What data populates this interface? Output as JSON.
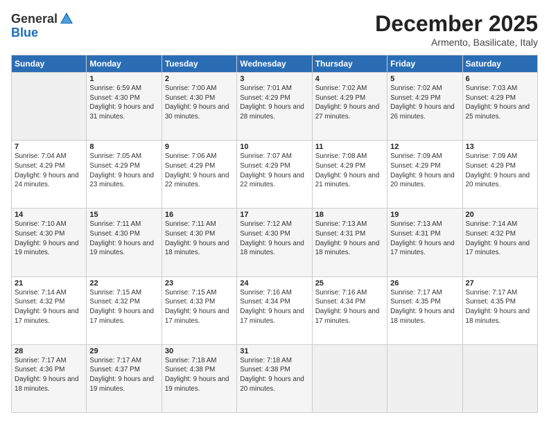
{
  "header": {
    "logo_general": "General",
    "logo_blue": "Blue",
    "month": "December 2025",
    "location": "Armento, Basilicate, Italy"
  },
  "weekdays": [
    "Sunday",
    "Monday",
    "Tuesday",
    "Wednesday",
    "Thursday",
    "Friday",
    "Saturday"
  ],
  "weeks": [
    [
      {
        "day": "",
        "sunrise": "",
        "sunset": "",
        "daylight": ""
      },
      {
        "day": "1",
        "sunrise": "Sunrise: 6:59 AM",
        "sunset": "Sunset: 4:30 PM",
        "daylight": "Daylight: 9 hours and 31 minutes."
      },
      {
        "day": "2",
        "sunrise": "Sunrise: 7:00 AM",
        "sunset": "Sunset: 4:30 PM",
        "daylight": "Daylight: 9 hours and 30 minutes."
      },
      {
        "day": "3",
        "sunrise": "Sunrise: 7:01 AM",
        "sunset": "Sunset: 4:29 PM",
        "daylight": "Daylight: 9 hours and 28 minutes."
      },
      {
        "day": "4",
        "sunrise": "Sunrise: 7:02 AM",
        "sunset": "Sunset: 4:29 PM",
        "daylight": "Daylight: 9 hours and 27 minutes."
      },
      {
        "day": "5",
        "sunrise": "Sunrise: 7:02 AM",
        "sunset": "Sunset: 4:29 PM",
        "daylight": "Daylight: 9 hours and 26 minutes."
      },
      {
        "day": "6",
        "sunrise": "Sunrise: 7:03 AM",
        "sunset": "Sunset: 4:29 PM",
        "daylight": "Daylight: 9 hours and 25 minutes."
      }
    ],
    [
      {
        "day": "7",
        "sunrise": "Sunrise: 7:04 AM",
        "sunset": "Sunset: 4:29 PM",
        "daylight": "Daylight: 9 hours and 24 minutes."
      },
      {
        "day": "8",
        "sunrise": "Sunrise: 7:05 AM",
        "sunset": "Sunset: 4:29 PM",
        "daylight": "Daylight: 9 hours and 23 minutes."
      },
      {
        "day": "9",
        "sunrise": "Sunrise: 7:06 AM",
        "sunset": "Sunset: 4:29 PM",
        "daylight": "Daylight: 9 hours and 22 minutes."
      },
      {
        "day": "10",
        "sunrise": "Sunrise: 7:07 AM",
        "sunset": "Sunset: 4:29 PM",
        "daylight": "Daylight: 9 hours and 22 minutes."
      },
      {
        "day": "11",
        "sunrise": "Sunrise: 7:08 AM",
        "sunset": "Sunset: 4:29 PM",
        "daylight": "Daylight: 9 hours and 21 minutes."
      },
      {
        "day": "12",
        "sunrise": "Sunrise: 7:09 AM",
        "sunset": "Sunset: 4:29 PM",
        "daylight": "Daylight: 9 hours and 20 minutes."
      },
      {
        "day": "13",
        "sunrise": "Sunrise: 7:09 AM",
        "sunset": "Sunset: 4:29 PM",
        "daylight": "Daylight: 9 hours and 20 minutes."
      }
    ],
    [
      {
        "day": "14",
        "sunrise": "Sunrise: 7:10 AM",
        "sunset": "Sunset: 4:30 PM",
        "daylight": "Daylight: 9 hours and 19 minutes."
      },
      {
        "day": "15",
        "sunrise": "Sunrise: 7:11 AM",
        "sunset": "Sunset: 4:30 PM",
        "daylight": "Daylight: 9 hours and 19 minutes."
      },
      {
        "day": "16",
        "sunrise": "Sunrise: 7:11 AM",
        "sunset": "Sunset: 4:30 PM",
        "daylight": "Daylight: 9 hours and 18 minutes."
      },
      {
        "day": "17",
        "sunrise": "Sunrise: 7:12 AM",
        "sunset": "Sunset: 4:30 PM",
        "daylight": "Daylight: 9 hours and 18 minutes."
      },
      {
        "day": "18",
        "sunrise": "Sunrise: 7:13 AM",
        "sunset": "Sunset: 4:31 PM",
        "daylight": "Daylight: 9 hours and 18 minutes."
      },
      {
        "day": "19",
        "sunrise": "Sunrise: 7:13 AM",
        "sunset": "Sunset: 4:31 PM",
        "daylight": "Daylight: 9 hours and 17 minutes."
      },
      {
        "day": "20",
        "sunrise": "Sunrise: 7:14 AM",
        "sunset": "Sunset: 4:32 PM",
        "daylight": "Daylight: 9 hours and 17 minutes."
      }
    ],
    [
      {
        "day": "21",
        "sunrise": "Sunrise: 7:14 AM",
        "sunset": "Sunset: 4:32 PM",
        "daylight": "Daylight: 9 hours and 17 minutes."
      },
      {
        "day": "22",
        "sunrise": "Sunrise: 7:15 AM",
        "sunset": "Sunset: 4:32 PM",
        "daylight": "Daylight: 9 hours and 17 minutes."
      },
      {
        "day": "23",
        "sunrise": "Sunrise: 7:15 AM",
        "sunset": "Sunset: 4:33 PM",
        "daylight": "Daylight: 9 hours and 17 minutes."
      },
      {
        "day": "24",
        "sunrise": "Sunrise: 7:16 AM",
        "sunset": "Sunset: 4:34 PM",
        "daylight": "Daylight: 9 hours and 17 minutes."
      },
      {
        "day": "25",
        "sunrise": "Sunrise: 7:16 AM",
        "sunset": "Sunset: 4:34 PM",
        "daylight": "Daylight: 9 hours and 17 minutes."
      },
      {
        "day": "26",
        "sunrise": "Sunrise: 7:17 AM",
        "sunset": "Sunset: 4:35 PM",
        "daylight": "Daylight: 9 hours and 18 minutes."
      },
      {
        "day": "27",
        "sunrise": "Sunrise: 7:17 AM",
        "sunset": "Sunset: 4:35 PM",
        "daylight": "Daylight: 9 hours and 18 minutes."
      }
    ],
    [
      {
        "day": "28",
        "sunrise": "Sunrise: 7:17 AM",
        "sunset": "Sunset: 4:36 PM",
        "daylight": "Daylight: 9 hours and 18 minutes."
      },
      {
        "day": "29",
        "sunrise": "Sunrise: 7:17 AM",
        "sunset": "Sunset: 4:37 PM",
        "daylight": "Daylight: 9 hours and 19 minutes."
      },
      {
        "day": "30",
        "sunrise": "Sunrise: 7:18 AM",
        "sunset": "Sunset: 4:38 PM",
        "daylight": "Daylight: 9 hours and 19 minutes."
      },
      {
        "day": "31",
        "sunrise": "Sunrise: 7:18 AM",
        "sunset": "Sunset: 4:38 PM",
        "daylight": "Daylight: 9 hours and 20 minutes."
      },
      {
        "day": "",
        "sunrise": "",
        "sunset": "",
        "daylight": ""
      },
      {
        "day": "",
        "sunrise": "",
        "sunset": "",
        "daylight": ""
      },
      {
        "day": "",
        "sunrise": "",
        "sunset": "",
        "daylight": ""
      }
    ]
  ]
}
